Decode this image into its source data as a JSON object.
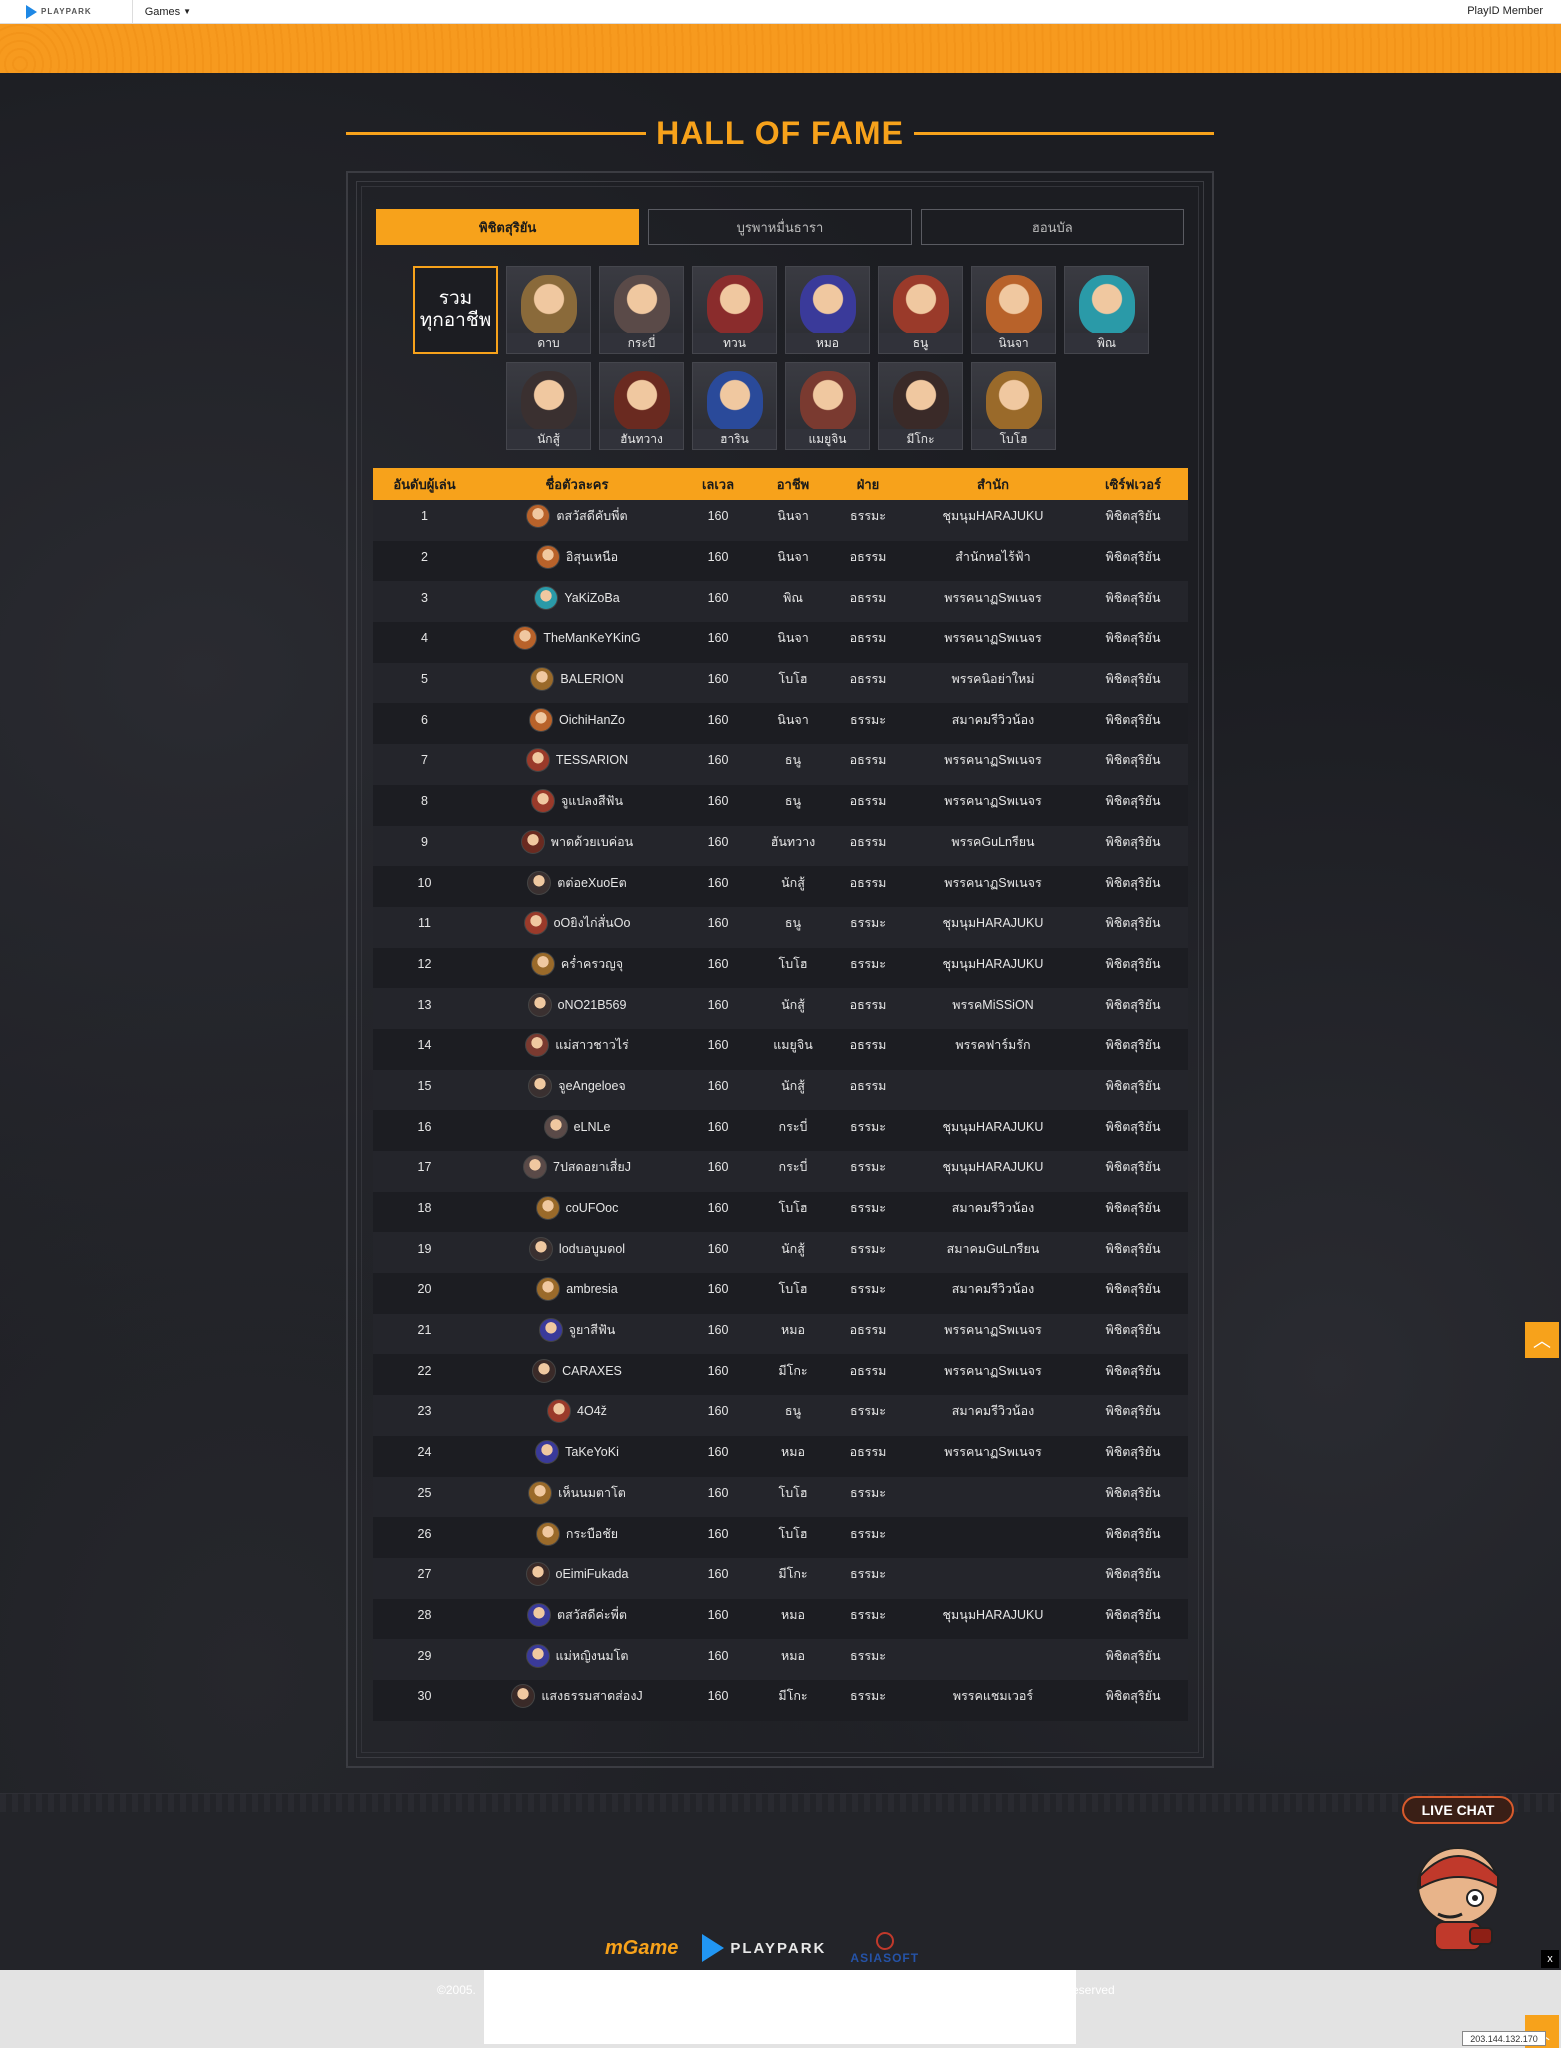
{
  "topbar": {
    "logo": "PLAYPARK",
    "games": "Games",
    "member": "PlayID Member"
  },
  "title": "HALL OF FAME",
  "tabs": [
    {
      "label": "พิชิตสุริยัน",
      "active": true
    },
    {
      "label": "บูรพาหมื่นธารา",
      "active": false
    },
    {
      "label": "ฮอนบัล",
      "active": false
    }
  ],
  "classes": {
    "all_line1": "รวม",
    "all_line2": "ทุกอาชีพ",
    "items": [
      {
        "label": "ดาบ",
        "color": "#8a6a3a"
      },
      {
        "label": "กระบี่",
        "color": "#5a4a48"
      },
      {
        "label": "ทวน",
        "color": "#8a2c2c"
      },
      {
        "label": "หมอ",
        "color": "#3a3a9a"
      },
      {
        "label": "ธนู",
        "color": "#9a3a2a"
      },
      {
        "label": "นินจา",
        "color": "#b8622a"
      },
      {
        "label": "พิณ",
        "color": "#2a9aa8"
      },
      {
        "label": "นักสู้",
        "color": "#3a3030"
      },
      {
        "label": "ฮันทวาง",
        "color": "#6a2a20"
      },
      {
        "label": "ฮาริน",
        "color": "#2a4a9a"
      },
      {
        "label": "แมยูจิน",
        "color": "#7a3a30"
      },
      {
        "label": "มีโกะ",
        "color": "#3a2a28"
      },
      {
        "label": "โบโฮ",
        "color": "#9a6a2a"
      }
    ]
  },
  "table": {
    "headers": [
      "อันดับผู้เล่น",
      "ชื่อตัวละคร",
      "เลเวล",
      "อาชีพ",
      "ฝ่าย",
      "สำนัก",
      "เซิร์ฟเวอร์"
    ],
    "rows": [
      {
        "rank": "1",
        "name": "ตสวัสดีคับพี่ต",
        "level": "160",
        "job": "นินจา",
        "side": "ธรรมะ",
        "guild": "ชุมนุมHARAJUKU",
        "server": "พิชิตสุริยัน",
        "avatar": "#b8622a"
      },
      {
        "rank": "2",
        "name": "อิสุนเหนือ",
        "level": "160",
        "job": "นินจา",
        "side": "อธรรม",
        "guild": "สำนักหอไร้ฟ้า",
        "server": "พิชิตสุริยัน",
        "avatar": "#b8622a"
      },
      {
        "rank": "3",
        "name": "YaKiZoBa",
        "level": "160",
        "job": "พิณ",
        "side": "อธรรม",
        "guild": "พรรคนาฏSพเนจร",
        "server": "พิชิตสุริยัน",
        "avatar": "#2a9aa8"
      },
      {
        "rank": "4",
        "name": "TheManKeYKinG",
        "level": "160",
        "job": "นินจา",
        "side": "อธรรม",
        "guild": "พรรคนาฏSพเนจร",
        "server": "พิชิตสุริยัน",
        "avatar": "#b8622a"
      },
      {
        "rank": "5",
        "name": "BALERION",
        "level": "160",
        "job": "โบโฮ",
        "side": "อธรรม",
        "guild": "พรรคนิอย่าใหม่",
        "server": "พิชิตสุริยัน",
        "avatar": "#9a6a2a"
      },
      {
        "rank": "6",
        "name": "OichiHanZo",
        "level": "160",
        "job": "นินจา",
        "side": "ธรรมะ",
        "guild": "สมาคมรีวิวน้อง",
        "server": "พิชิตสุริยัน",
        "avatar": "#b8622a"
      },
      {
        "rank": "7",
        "name": "TESSARION",
        "level": "160",
        "job": "ธนู",
        "side": "อธรรม",
        "guild": "พรรคนาฏSพเนจร",
        "server": "พิชิตสุริยัน",
        "avatar": "#9a3a2a"
      },
      {
        "rank": "8",
        "name": "จูแปลงสีฟัน",
        "level": "160",
        "job": "ธนู",
        "side": "อธรรม",
        "guild": "พรรคนาฏSพเนจร",
        "server": "พิชิตสุริยัน",
        "avatar": "#9a3a2a"
      },
      {
        "rank": "9",
        "name": "พาดด้วยเบค่อน",
        "level": "160",
        "job": "ฮันทวาง",
        "side": "อธรรม",
        "guild": "พรรคGuLnรียน",
        "server": "พิชิตสุริยัน",
        "avatar": "#6a2a20"
      },
      {
        "rank": "10",
        "name": "ตต่อeXuoEต",
        "level": "160",
        "job": "นักสู้",
        "side": "อธรรม",
        "guild": "พรรคนาฏSพเนจร",
        "server": "พิชิตสุริยัน",
        "avatar": "#3a3030"
      },
      {
        "rank": "11",
        "name": "oOยิงไก่สั่นOo",
        "level": "160",
        "job": "ธนู",
        "side": "ธรรมะ",
        "guild": "ชุมนุมHARAJUKU",
        "server": "พิชิตสุริยัน",
        "avatar": "#9a3a2a"
      },
      {
        "rank": "12",
        "name": "คร่ำครวญจุ",
        "level": "160",
        "job": "โบโฮ",
        "side": "ธรรมะ",
        "guild": "ชุมนุมHARAJUKU",
        "server": "พิชิตสุริยัน",
        "avatar": "#9a6a2a"
      },
      {
        "rank": "13",
        "name": "oNO21B569",
        "level": "160",
        "job": "นักสู้",
        "side": "อธรรม",
        "guild": "พรรคMiSSiON",
        "server": "พิชิตสุริยัน",
        "avatar": "#3a3030"
      },
      {
        "rank": "14",
        "name": "แม่สาวชาวไร่",
        "level": "160",
        "job": "แมยูจิน",
        "side": "อธรรม",
        "guild": "พรรคฟาร์มรัก",
        "server": "พิชิตสุริยัน",
        "avatar": "#7a3a30"
      },
      {
        "rank": "15",
        "name": "จูeAngeloeจ",
        "level": "160",
        "job": "นักสู้",
        "side": "อธรรม",
        "guild": "",
        "server": "พิชิตสุริยัน",
        "avatar": "#3a3030"
      },
      {
        "rank": "16",
        "name": "eLNLe",
        "level": "160",
        "job": "กระบี่",
        "side": "ธรรมะ",
        "guild": "ชุมนุมHARAJUKU",
        "server": "พิชิตสุริยัน",
        "avatar": "#5a4a48"
      },
      {
        "rank": "17",
        "name": "7ปสดอยาเสี่ยJ",
        "level": "160",
        "job": "กระบี่",
        "side": "ธรรมะ",
        "guild": "ชุมนุมHARAJUKU",
        "server": "พิชิตสุริยัน",
        "avatar": "#5a4a48"
      },
      {
        "rank": "18",
        "name": "coUFOoc",
        "level": "160",
        "job": "โบโฮ",
        "side": "ธรรมะ",
        "guild": "สมาคมรีวิวน้อง",
        "server": "พิชิตสุริยัน",
        "avatar": "#9a6a2a"
      },
      {
        "rank": "19",
        "name": "lodบอบูมดol",
        "level": "160",
        "job": "นักสู้",
        "side": "ธรรมะ",
        "guild": "สมาคมGuLnรียน",
        "server": "พิชิตสุริยัน",
        "avatar": "#3a3030"
      },
      {
        "rank": "20",
        "name": "ambresia",
        "level": "160",
        "job": "โบโฮ",
        "side": "ธรรมะ",
        "guild": "สมาคมรีวิวน้อง",
        "server": "พิชิตสุริยัน",
        "avatar": "#9a6a2a"
      },
      {
        "rank": "21",
        "name": "จูยาสีฟัน",
        "level": "160",
        "job": "หมอ",
        "side": "อธรรม",
        "guild": "พรรคนาฏSพเนจร",
        "server": "พิชิตสุริยัน",
        "avatar": "#3a3a9a"
      },
      {
        "rank": "22",
        "name": "CARAXES",
        "level": "160",
        "job": "มีโกะ",
        "side": "อธรรม",
        "guild": "พรรคนาฏSพเนจร",
        "server": "พิชิตสุริยัน",
        "avatar": "#3a2a28"
      },
      {
        "rank": "23",
        "name": "4O4ž",
        "level": "160",
        "job": "ธนู",
        "side": "ธรรมะ",
        "guild": "สมาคมรีวิวน้อง",
        "server": "พิชิตสุริยัน",
        "avatar": "#9a3a2a"
      },
      {
        "rank": "24",
        "name": "TaKeYoKi",
        "level": "160",
        "job": "หมอ",
        "side": "อธรรม",
        "guild": "พรรคนาฏSพเนจร",
        "server": "พิชิตสุริยัน",
        "avatar": "#3a3a9a"
      },
      {
        "rank": "25",
        "name": "เห็นนมตาโต",
        "level": "160",
        "job": "โบโฮ",
        "side": "ธรรมะ",
        "guild": "",
        "server": "พิชิตสุริยัน",
        "avatar": "#9a6a2a"
      },
      {
        "rank": "26",
        "name": "กระบือชัย",
        "level": "160",
        "job": "โบโฮ",
        "side": "ธรรมะ",
        "guild": "",
        "server": "พิชิตสุริยัน",
        "avatar": "#9a6a2a"
      },
      {
        "rank": "27",
        "name": "oEimiFukada",
        "level": "160",
        "job": "มีโกะ",
        "side": "ธรรมะ",
        "guild": "",
        "server": "พิชิตสุริยัน",
        "avatar": "#3a2a28"
      },
      {
        "rank": "28",
        "name": "ตสวัสดีค่ะพี่ต",
        "level": "160",
        "job": "หมอ",
        "side": "ธรรมะ",
        "guild": "ชุมนุมHARAJUKU",
        "server": "พิชิตสุริยัน",
        "avatar": "#3a3a9a"
      },
      {
        "rank": "29",
        "name": "แม่หญิงนมโต",
        "level": "160",
        "job": "หมอ",
        "side": "ธรรมะ",
        "guild": "",
        "server": "พิชิตสุริยัน",
        "avatar": "#3a3a9a"
      },
      {
        "rank": "30",
        "name": "แสงธรรมสาดส่องJ",
        "level": "160",
        "job": "มีโกะ",
        "side": "ธรรมะ",
        "guild": "พรรคแชมเวอร์",
        "server": "พิชิตสุริยัน",
        "avatar": "#3a2a28"
      }
    ]
  },
  "footer": {
    "logo_mgame": "mGame",
    "logo_playpark": "PLAYPARK",
    "logo_asiasoft": "ASIASOFT",
    "copyright_left": "©2005.",
    "copyright_right": "eserved",
    "live_chat": "LIVE CHAT",
    "close": "x",
    "ip": "203.144.132.170"
  },
  "colors": {
    "accent": "#f7a21b",
    "background": "#1c1d22"
  },
  "icons": {
    "scroll_top": "chevron-up-icon",
    "dropdown": "caret-down-icon"
  }
}
